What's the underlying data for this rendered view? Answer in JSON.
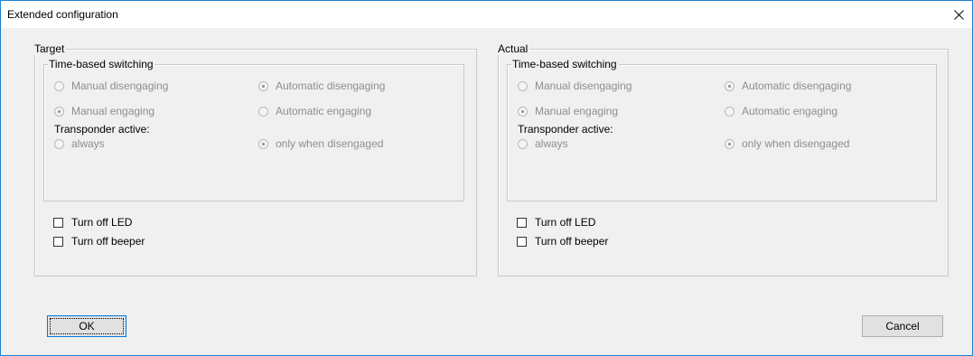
{
  "window": {
    "title": "Extended configuration"
  },
  "target": {
    "legend": "Target",
    "switching": {
      "legend": "Time-based switching",
      "manual_disengaging": "Manual disengaging",
      "automatic_disengaging": "Automatic disengaging",
      "manual_engaging": "Manual engaging",
      "automatic_engaging": "Automatic engaging",
      "transponder_label": "Transponder active:",
      "always": "always",
      "only_when_disengaged": "only when disengaged"
    },
    "turn_off_led": "Turn off LED",
    "turn_off_beeper": "Turn off beeper"
  },
  "actual": {
    "legend": "Actual",
    "switching": {
      "legend": "Time-based switching",
      "manual_disengaging": "Manual disengaging",
      "automatic_disengaging": "Automatic disengaging",
      "manual_engaging": "Manual engaging",
      "automatic_engaging": "Automatic engaging",
      "transponder_label": "Transponder active:",
      "always": "always",
      "only_when_disengaged": "only when disengaged"
    },
    "turn_off_led": "Turn off LED",
    "turn_off_beeper": "Turn off beeper"
  },
  "buttons": {
    "ok": "OK",
    "cancel": "Cancel"
  },
  "states": {
    "disengaging": "automatic",
    "engaging": "manual",
    "transponder": "only_when_disengaged",
    "led_checked": false,
    "beeper_checked": false
  },
  "colors": {
    "window_border": "#1883d7",
    "dialog_bg": "#f0f0f0",
    "disabled_text": "#8e8e8e"
  }
}
